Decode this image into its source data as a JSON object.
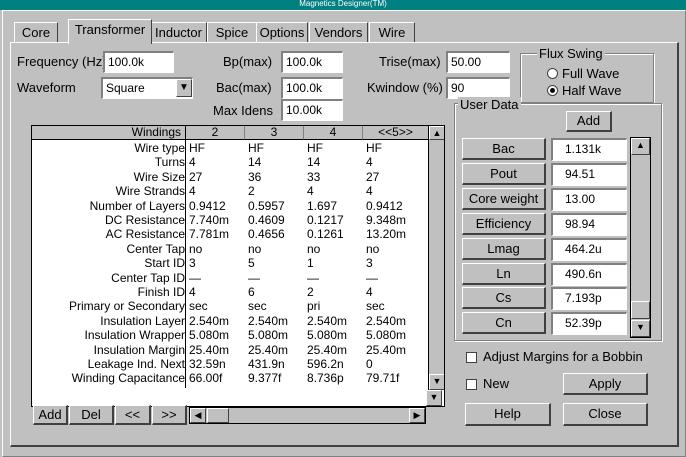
{
  "window_title": "Magnetics Designer(TM)",
  "tabs": [
    "Core",
    "Transformer",
    "Inductor",
    "Spice",
    "Options",
    "Vendors",
    "Wire"
  ],
  "form": {
    "frequency_label": "Frequency (Hz)",
    "frequency_value": "100.0k",
    "waveform_label": "Waveform",
    "waveform_value": "Square",
    "bpmax_label": "Bp(max)",
    "bpmax_value": "100.0k",
    "bacmax_label": "Bac(max)",
    "bacmax_value": "100.0k",
    "maxidens_label": "Max Idens",
    "maxidens_value": "10.00k",
    "trise_label": "Trise(max)",
    "trise_value": "50.00",
    "kwindow_label": "Kwindow (%)",
    "kwindow_value": "90"
  },
  "flux_swing": {
    "label": "Flux Swing",
    "options": [
      "Full Wave",
      "Half Wave"
    ],
    "selected": "Half Wave"
  },
  "grid": {
    "corner": "Windings",
    "columns": [
      "2",
      "3",
      "4",
      "<<5>>"
    ],
    "rows": [
      {
        "label": "Wire type",
        "values": [
          "HF",
          "HF",
          "HF",
          "HF"
        ]
      },
      {
        "label": "Turns",
        "values": [
          "4",
          "14",
          "14",
          "4"
        ]
      },
      {
        "label": "Wire Size",
        "values": [
          "27",
          "36",
          "33",
          "27"
        ]
      },
      {
        "label": "Wire Strands",
        "values": [
          "4",
          "2",
          "4",
          "4"
        ]
      },
      {
        "label": "Number of Layers",
        "values": [
          "0.9412",
          "0.5957",
          "1.697",
          "0.9412"
        ]
      },
      {
        "label": "DC Resistance",
        "values": [
          "7.740m",
          "0.4609",
          "0.1217",
          "9.348m"
        ]
      },
      {
        "label": "AC Resistance",
        "values": [
          "7.781m",
          "0.4656",
          "0.1261",
          "13.20m"
        ]
      },
      {
        "label": "Center Tap",
        "values": [
          "no",
          "no",
          "no",
          "no"
        ]
      },
      {
        "label": "Start ID",
        "values": [
          "3",
          "5",
          "1",
          "3"
        ]
      },
      {
        "label": "Center Tap ID",
        "values": [
          "—",
          "—",
          "—",
          "—"
        ]
      },
      {
        "label": "Finish ID",
        "values": [
          "4",
          "6",
          "2",
          "4"
        ]
      },
      {
        "label": "Primary or Secondary",
        "values": [
          "sec",
          "sec",
          "pri",
          "sec"
        ]
      },
      {
        "label": "Insulation  Layer",
        "values": [
          "2.540m",
          "2.540m",
          "2.540m",
          "2.540m"
        ]
      },
      {
        "label": "Insulation Wrapper",
        "values": [
          "5.080m",
          "5.080m",
          "5.080m",
          "5.080m"
        ]
      },
      {
        "label": "Insulation Margin",
        "values": [
          "25.40m",
          "25.40m",
          "25.40m",
          "25.40m"
        ]
      },
      {
        "label": "Leakage Ind. Next",
        "values": [
          "32.59n",
          "431.9n",
          "596.2n",
          "0"
        ]
      },
      {
        "label": "Winding Capacitance",
        "values": [
          "66.00f",
          "9.377f",
          "8.736p",
          "79.71f"
        ]
      }
    ],
    "buttons": [
      "Add",
      "Del",
      "<<",
      ">>"
    ]
  },
  "user_data": {
    "label": "User Data",
    "add_label": "Add",
    "items": [
      {
        "name": "Bac",
        "value": "1.131k"
      },
      {
        "name": "Pout",
        "value": "94.51"
      },
      {
        "name": "Core weight",
        "value": "13.00"
      },
      {
        "name": "Efficiency",
        "value": "98.94"
      },
      {
        "name": "Lmag",
        "value": "464.2u"
      },
      {
        "name": "Ln",
        "value": "490.6n"
      },
      {
        "name": "Cs",
        "value": "7.193p"
      },
      {
        "name": "Cn",
        "value": "52.39p"
      }
    ]
  },
  "adjust_margins_label": "Adjust Margins for a Bobbin",
  "new_label": "New",
  "apply_label": "Apply",
  "help_label": "Help",
  "close_label": "Close"
}
